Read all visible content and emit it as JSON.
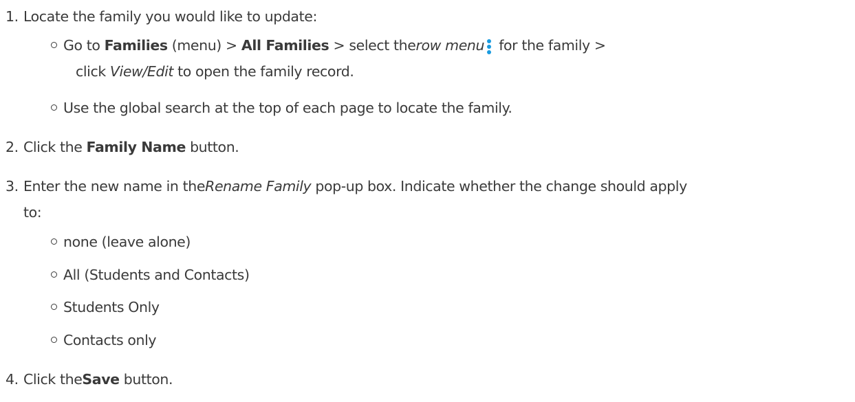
{
  "steps": [
    {
      "number": "1.",
      "text": "Locate the family you would like to update:",
      "bullets": [
        {
          "prefix": "Go to ",
          "families_menu": "Families",
          "menu_suffix": " (menu) > ",
          "all_families": "All Families",
          "select_text": " > select the",
          "row_menu": "row menu",
          "after_icon": " for the family >",
          "line2_prefix": "click ",
          "view_edit": "View/Edit",
          "line2_suffix": " to open the family record."
        },
        {
          "text": "Use the global search at the top of each page to locate the family."
        }
      ]
    },
    {
      "number": "2.",
      "prefix": "Click the",
      "bold": "Family Name",
      "suffix": " button."
    },
    {
      "number": "3.",
      "prefix": "Enter the new name in the",
      "italic": "Rename Family",
      "suffix": " pop-up box. Indicate whether the change should apply",
      "continuation": "to:",
      "options": [
        "none (leave alone)",
        "All (Students and Contacts)",
        "Students Only",
        "Contacts only"
      ]
    },
    {
      "number": "4.",
      "prefix": "Click the",
      "bold": "Save",
      "suffix": " button."
    }
  ],
  "icon_color": "#1a9be0"
}
